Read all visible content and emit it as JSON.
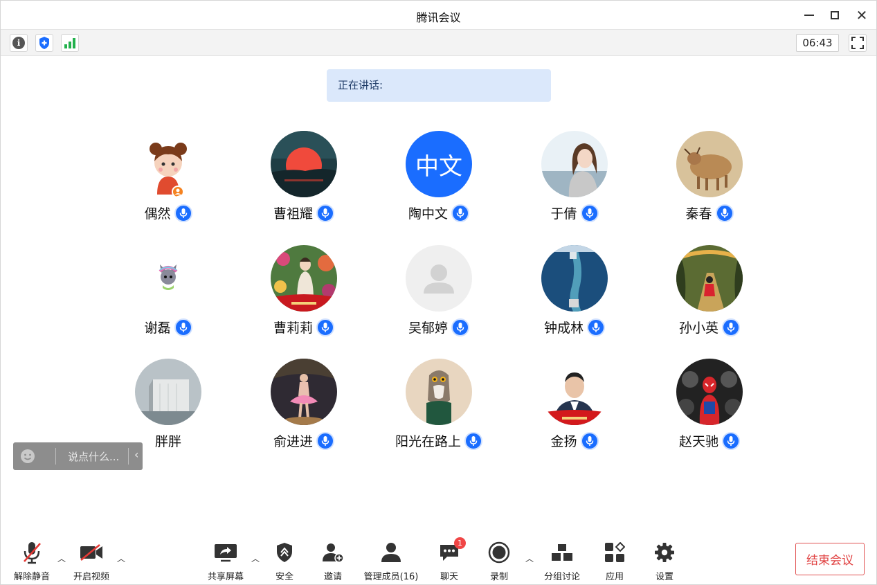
{
  "window": {
    "title": "腾讯会议"
  },
  "infobar": {
    "timer": "06:43"
  },
  "speaking": {
    "label": "正在讲话:"
  },
  "participants": [
    {
      "name": "偶然",
      "avatar": "cartoon-girl",
      "mic": true
    },
    {
      "name": "曹祖耀",
      "avatar": "sunset",
      "mic": true
    },
    {
      "name": "陶中文",
      "avatar": "text",
      "avatar_text": "中文",
      "mic": true
    },
    {
      "name": "于倩",
      "avatar": "woman-portrait",
      "mic": true
    },
    {
      "name": "秦春",
      "avatar": "ox-painting",
      "mic": true
    },
    {
      "name": "谢磊",
      "avatar": "cartoon-cat",
      "mic": true
    },
    {
      "name": "曹莉莉",
      "avatar": "woman-flowers",
      "mic": true
    },
    {
      "name": "吴郁婷",
      "avatar": "default-user",
      "mic": true
    },
    {
      "name": "钟成林",
      "avatar": "ship-sea",
      "mic": true
    },
    {
      "name": "孙小英",
      "avatar": "autumn-path",
      "mic": true
    },
    {
      "name": "胖胖",
      "avatar": "building",
      "mic": false
    },
    {
      "name": "俞进进",
      "avatar": "ballet-girl",
      "mic": true
    },
    {
      "name": "阳光在路上",
      "avatar": "owl",
      "mic": true
    },
    {
      "name": "金扬",
      "avatar": "man-portrait",
      "mic": true
    },
    {
      "name": "赵天驰",
      "avatar": "spiderman",
      "mic": true
    }
  ],
  "chat": {
    "placeholder": "说点什么..."
  },
  "toolbar": {
    "unmute": "解除静音",
    "video": "开启视频",
    "share": "共享屏幕",
    "security": "安全",
    "invite": "邀请",
    "members": "管理成员(16)",
    "chat": "聊天",
    "chat_badge": "1",
    "record": "录制",
    "breakout": "分组讨论",
    "apps": "应用",
    "settings": "设置",
    "end": "结束会议"
  },
  "colors": {
    "accent": "#1a6dff",
    "end": "#e04040",
    "banner": "#dbe8fb"
  }
}
